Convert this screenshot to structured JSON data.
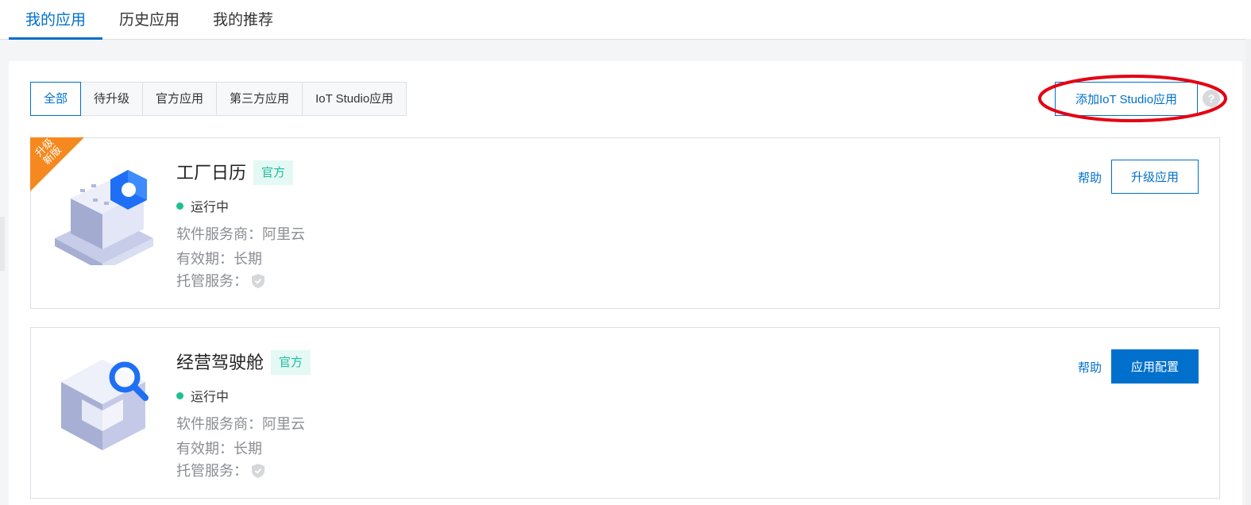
{
  "top_tabs": [
    {
      "label": "我的应用"
    },
    {
      "label": "历史应用"
    },
    {
      "label": "我的推荐"
    }
  ],
  "filters": [
    {
      "label": "全部",
      "active": true
    },
    {
      "label": "待升级"
    },
    {
      "label": "官方应用"
    },
    {
      "label": "第三方应用"
    },
    {
      "label": "IoT Studio应用"
    }
  ],
  "toolbar": {
    "add_label": "添加IoT Studio应用",
    "help_icon": "?"
  },
  "apps": [
    {
      "ribbon": "升级\n新版",
      "title": "工厂日历",
      "tag": "官方",
      "status": "运行中",
      "vendor": "软件服务商：阿里云",
      "validity": "有效期：长期",
      "hosting": "托管服务：",
      "help": "帮助",
      "action": "升级应用"
    },
    {
      "title": "经营驾驶舱",
      "tag": "官方",
      "status": "运行中",
      "vendor": "软件服务商：阿里云",
      "validity": "有效期：长期",
      "hosting": "托管服务：",
      "help": "帮助",
      "action": "应用配置"
    }
  ],
  "colors": {
    "accent": "#0070cc",
    "status_running": "#1fbf8f",
    "tag_text": "#1fbf9e",
    "tag_bg": "#e4f8f4",
    "ribbon": "#f5891f",
    "annotation_ellipse": "#e50012"
  }
}
